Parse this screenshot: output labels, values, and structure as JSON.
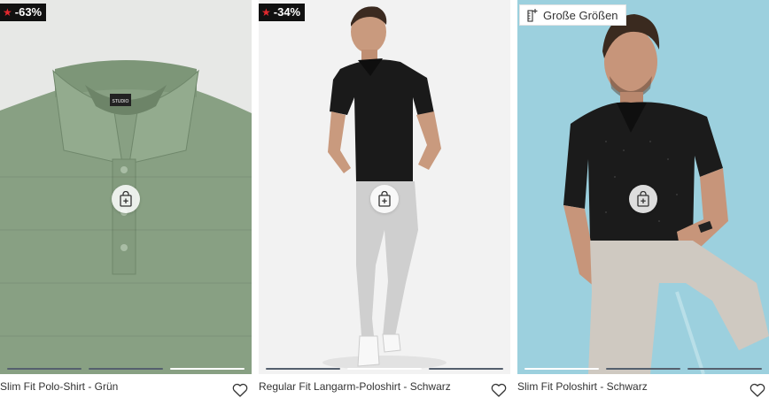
{
  "products": [
    {
      "title": "Slim Fit Polo-Shirt - Grün",
      "badge": "-63%",
      "chip": "",
      "bg": "#e7e8e6",
      "garment": "#88a083",
      "collar_label": "STUDIO",
      "active_dot": 2
    },
    {
      "title": "Regular Fit Langarm-Poloshirt - Schwarz",
      "badge": "-34%",
      "chip": "",
      "bg": "#f2f2f2",
      "garment": "#1a1a1a",
      "active_dot": 1
    },
    {
      "title": "Slim Fit Poloshirt - Schwarz",
      "badge": "",
      "chip": "Große Größen",
      "bg": "#9cd0de",
      "garment": "#1b1b1b",
      "active_dot": 0
    }
  ],
  "icons": {
    "badge_icon": "star-icon",
    "chip_icon": "size-ruler-icon",
    "action_icon": "shopping-bag-plus-icon",
    "wishlist_icon": "heart-icon"
  },
  "colors": {
    "badge_bg": "#111111",
    "badge_star": "#e2282e",
    "dot_inactive": "#55606e",
    "dot_active": "#ffffff"
  }
}
